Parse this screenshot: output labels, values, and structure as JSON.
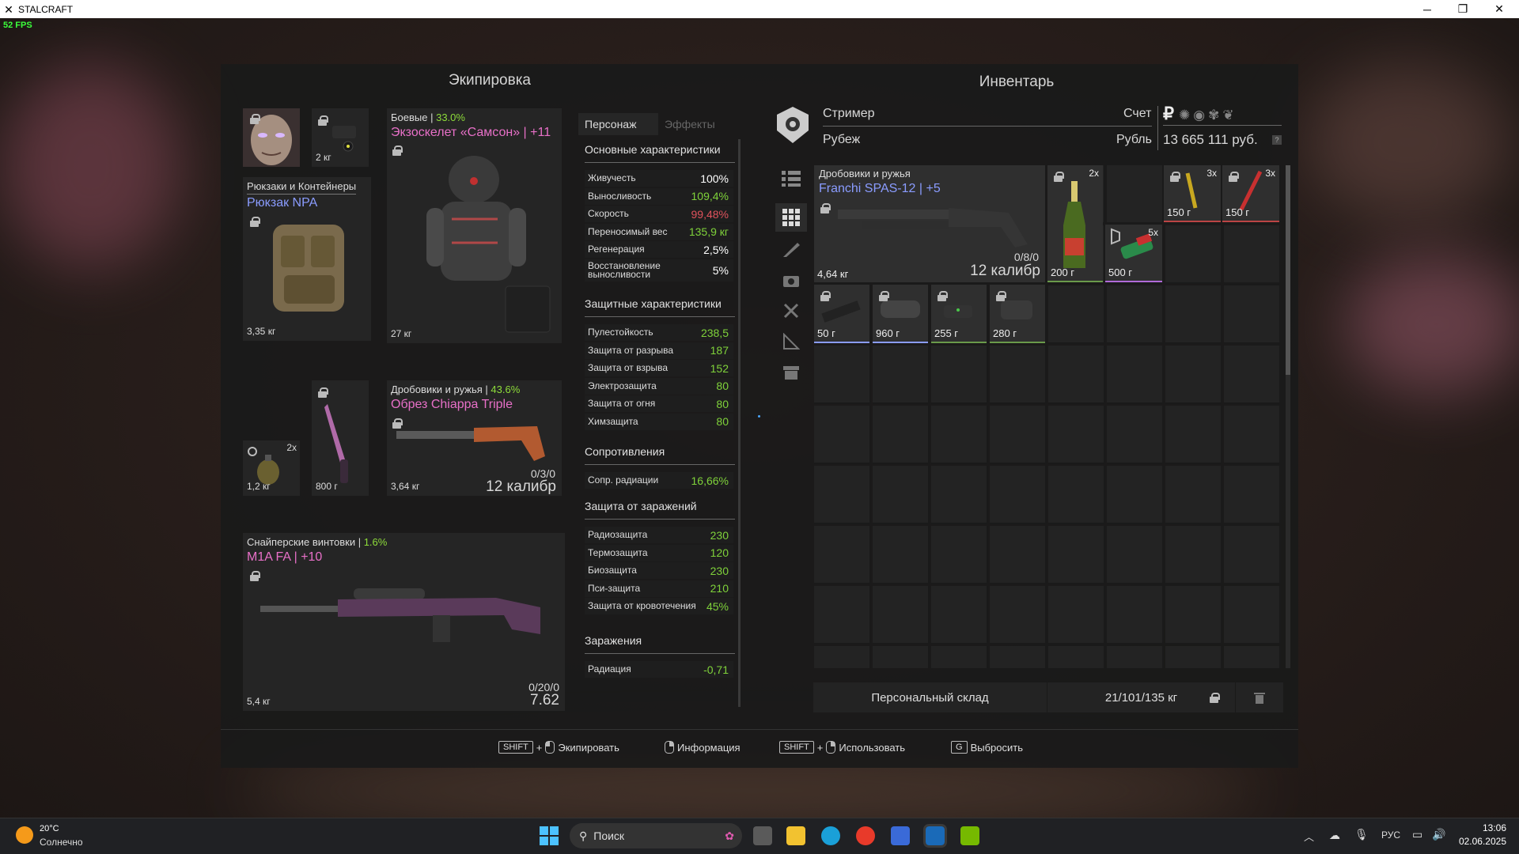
{
  "window": {
    "title": "STALCRAFT",
    "fps": "52 FPS"
  },
  "equipment": {
    "title": "Экипировка",
    "head_weight": "2 кг",
    "backpack": {
      "category": "Рюкзаки и Контейнеры",
      "name": "Рюкзак NPA",
      "weight": "3,35 кг"
    },
    "armor": {
      "category": "Боевые",
      "percent": "33.0%",
      "name": "Экзоскелет «Самсон» | +11",
      "weight": "27 кг"
    },
    "grenade": {
      "count": "2x",
      "weight": "1,2 кг"
    },
    "knife": {
      "weight": "800 г"
    },
    "shotgun": {
      "category": "Дробовики и ружья",
      "percent": "43.6%",
      "name": "Обрез Chiappa Triple",
      "weight": "3,64 кг",
      "ammo": "0/3/0",
      "caliber": "12 калибр"
    },
    "sniper": {
      "category": "Снайперские винтовки",
      "percent": "1.6%",
      "name": "M1A FA | +10",
      "weight": "5,4 кг",
      "ammo": "0/20/0",
      "caliber": "7.62"
    }
  },
  "stats": {
    "tabs": [
      "Персонаж",
      "Эффекты"
    ],
    "main_title": "Основные характеристики",
    "main": [
      {
        "name": "Живучесть",
        "value": "100%",
        "color": "#ffffff"
      },
      {
        "name": "Выносливость",
        "value": "109,4%",
        "color": "#7fd23a"
      },
      {
        "name": "Скорость",
        "value": "99,48%",
        "color": "#e0525c"
      },
      {
        "name": "Переносимый вес",
        "value": "135,9 кг",
        "color": "#7fd23a"
      },
      {
        "name": "Регенерация",
        "value": "2,5%",
        "color": "#ffffff"
      },
      {
        "name": "Восстановление выносливости",
        "value": "5%",
        "color": "#ffffff"
      }
    ],
    "defense_title": "Защитные характеристики",
    "defense": [
      {
        "name": "Пулестойкость",
        "value": "238,5",
        "color": "#7fd23a"
      },
      {
        "name": "Защита от разрыва",
        "value": "187",
        "color": "#7fd23a"
      },
      {
        "name": "Защита от взрыва",
        "value": "152",
        "color": "#7fd23a"
      },
      {
        "name": "Электрозащита",
        "value": "80",
        "color": "#7fd23a"
      },
      {
        "name": "Защита от огня",
        "value": "80",
        "color": "#7fd23a"
      },
      {
        "name": "Химзащита",
        "value": "80",
        "color": "#7fd23a"
      }
    ],
    "resist_title": "Сопротивления",
    "resist": [
      {
        "name": "Сопр. радиации",
        "value": "16,66%",
        "color": "#7fd23a"
      }
    ],
    "infection_title": "Защита от заражений",
    "infection": [
      {
        "name": "Радиозащита",
        "value": "230",
        "color": "#7fd23a"
      },
      {
        "name": "Термозащита",
        "value": "120",
        "color": "#7fd23a"
      },
      {
        "name": "Биозащита",
        "value": "230",
        "color": "#7fd23a"
      },
      {
        "name": "Пси-защита",
        "value": "210",
        "color": "#7fd23a"
      },
      {
        "name": "Защита от кровотечения",
        "value": "45%",
        "color": "#7fd23a"
      }
    ],
    "contam_title": "Заражения",
    "contam": [
      {
        "name": "Радиация",
        "value": "-0,71",
        "color": "#7fd23a"
      }
    ]
  },
  "inventory": {
    "title": "Инвентарь",
    "player": "Стример",
    "faction": "Рубеж",
    "account_label": "Счет",
    "currency_label": "Рубль",
    "money": "13 665 111 руб.",
    "currency_symbol": "₽",
    "weapon": {
      "category": "Дробовики и ружья",
      "name": "Franchi SPAS-12 | +5",
      "weight": "4,64 кг",
      "ammo": "0/8/0",
      "caliber": "12 калибр"
    },
    "items": [
      {
        "id": "champagne",
        "count": "2x",
        "weight": "200 г"
      },
      {
        "id": "flare-yellow",
        "count": "3x",
        "weight": "150 г"
      },
      {
        "id": "flare-red",
        "count": "3x",
        "weight": "150 г"
      },
      {
        "id": "medkit",
        "count": "5x",
        "weight": "500 г"
      },
      {
        "id": "rail",
        "weight": "50 г"
      },
      {
        "id": "scope1",
        "weight": "960 г"
      },
      {
        "id": "scope2",
        "weight": "255 г"
      },
      {
        "id": "scope3",
        "weight": "280 г"
      }
    ],
    "storage_label": "Персональный склад",
    "capacity": "21/101/135 кг"
  },
  "hints": {
    "shift": "SHIFT",
    "plus": "+",
    "equip": "Экипировать",
    "info": "Информация",
    "use": "Использовать",
    "drop_key": "G",
    "drop": "Выбросить"
  },
  "taskbar": {
    "temp": "20°C",
    "weather": "Солнечно",
    "search": "Поиск",
    "lang": "РУС",
    "time": "13:06",
    "date": "02.06.2025"
  }
}
